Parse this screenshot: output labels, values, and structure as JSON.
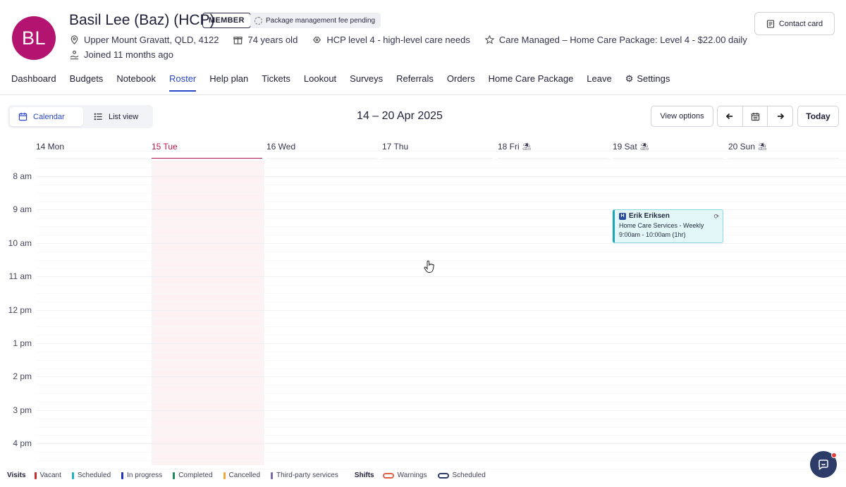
{
  "client": {
    "initials": "BL",
    "name": "Basil Lee (Baz) (HCP)",
    "member_badge": "MEMBER",
    "fee_badge": "Package management fee pending",
    "location": "Upper Mount Gravatt, QLD, 4122",
    "age": "74 years old",
    "hcp_level": "HCP level 4 - high-level care needs",
    "care_managed": "Care Managed – Home Care Package: Level 4 - $22.00 daily",
    "joined": "Joined 11 months ago",
    "avatar_color": "#b3146f"
  },
  "header": {
    "contact_card_label": "Contact card"
  },
  "tabs": [
    {
      "label": "Dashboard",
      "active": false
    },
    {
      "label": "Budgets",
      "active": false
    },
    {
      "label": "Notebook",
      "active": false
    },
    {
      "label": "Roster",
      "active": true
    },
    {
      "label": "Help plan",
      "active": false
    },
    {
      "label": "Tickets",
      "active": false
    },
    {
      "label": "Lookout",
      "active": false
    },
    {
      "label": "Surveys",
      "active": false
    },
    {
      "label": "Referrals",
      "active": false
    },
    {
      "label": "Orders",
      "active": false
    },
    {
      "label": "Home Care Package",
      "active": false
    },
    {
      "label": "Leave",
      "active": false
    },
    {
      "label": "Settings",
      "active": false,
      "icon": "gear-icon"
    }
  ],
  "toolbar": {
    "calendar_label": "Calendar",
    "list_view_label": "List view",
    "date_range": "14 – 20 Apr 2025",
    "view_options_label": "View options",
    "today_label": "Today"
  },
  "days": [
    {
      "label": "14 Mon",
      "today": false,
      "weekend_icon": false
    },
    {
      "label": "15 Tue",
      "today": true,
      "weekend_icon": false
    },
    {
      "label": "16 Wed",
      "today": false,
      "weekend_icon": false
    },
    {
      "label": "17 Thu",
      "today": false,
      "weekend_icon": false
    },
    {
      "label": "18 Fri",
      "today": false,
      "weekend_icon": true
    },
    {
      "label": "19 Sat",
      "today": false,
      "weekend_icon": true
    },
    {
      "label": "20 Sun",
      "today": false,
      "weekend_icon": true
    }
  ],
  "hours": [
    "8 am",
    "9 am",
    "10 am",
    "11 am",
    "12 pm",
    "1 pm",
    "2 pm",
    "3 pm",
    "4 pm"
  ],
  "event": {
    "badge": "H",
    "worker": "Erik Eriksen",
    "service": "Home Care Services - Weekly",
    "time": "9:00am - 10:00am (1hr)",
    "day": "19 Sat"
  },
  "legend": {
    "visits_label": "Visits",
    "visits": [
      {
        "label": "Vacant",
        "color": "#c8312f"
      },
      {
        "label": "Scheduled",
        "color": "#24b2c0"
      },
      {
        "label": "In progress",
        "color": "#2233b8"
      },
      {
        "label": "Completed",
        "color": "#1e8a5c"
      },
      {
        "label": "Cancelled",
        "color": "#f2a93b"
      },
      {
        "label": "Third-party services",
        "color": "#7a6aa8"
      }
    ],
    "shifts_label": "Shifts",
    "shifts": [
      {
        "label": "Warnings",
        "color": "#e0604a"
      },
      {
        "label": "Scheduled",
        "color": "#2d3b68"
      }
    ]
  },
  "colors": {
    "accent": "#2b48c8",
    "today": "#b3144e"
  }
}
